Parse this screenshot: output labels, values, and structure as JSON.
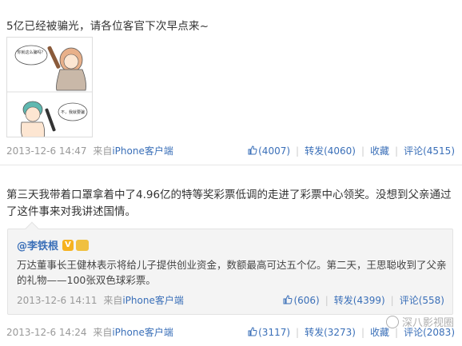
{
  "post1": {
    "text": "5亿已经被骗光，请各位客官下次早点来~",
    "comic": {
      "bubble_top": "你就这么骗吗？",
      "bubble_bottom": "不，我就要骗"
    },
    "time": "2013-12-6 14:47",
    "source_prefix": "来自",
    "source": "iPhone客户端",
    "like_count": "(4007)",
    "repost_label": "转发(4060)",
    "favorite_label": "收藏",
    "comment_label": "评论(4515)"
  },
  "post2": {
    "text": "第三天我带着口罩拿着中了4.96亿的特等奖彩票低调的走进了彩票中心领奖。没想到父亲通过了这件事来对我讲述国情。",
    "repost": {
      "author": "@李铁根",
      "v_badge": "V",
      "text": "万达董事长王健林表示将给儿子提供创业资金，数额最高可达五个亿。第二天，王思聪收到了父亲的礼物——100张双色球彩票。",
      "time": "2013-12-6 14:11",
      "source_prefix": "来自",
      "source": "iPhone客户端",
      "like_count": "(606)",
      "repost_label": "转发(4399)",
      "comment_label": "评论(558)"
    },
    "time": "2013-12-6 14:24",
    "source_prefix": "来自",
    "source": "iPhone客户端",
    "like_count": "(3117)",
    "repost_label": "转发(3273)",
    "favorite_label": "收藏",
    "comment_label": "评论(2083)"
  },
  "watermark": "深八影视圈",
  "colors": {
    "link": "#3a6fb8",
    "meta": "#999999",
    "repost_bg": "#f4f4f4"
  }
}
